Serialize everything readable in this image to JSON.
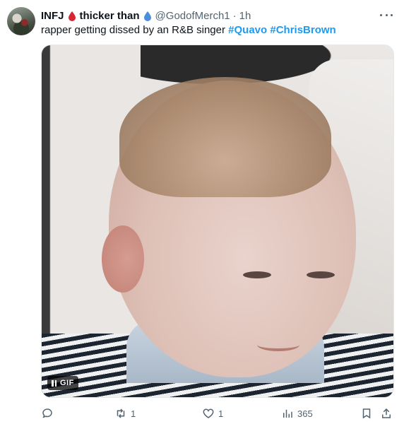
{
  "author": {
    "display_name": "INFJ",
    "display_name_suffix": "thicker than",
    "handle": "@GodofMerch1",
    "separator": "·",
    "timestamp": "1h",
    "drop1_color": "#d6262f",
    "drop2_color": "#4a90d9"
  },
  "tweet": {
    "text": "rapper getting dissed by an R&B singer",
    "hashtags": [
      "#Quavo",
      "#ChrisBrown"
    ]
  },
  "media": {
    "badge_label": "GIF"
  },
  "actions": {
    "reply_count": "",
    "retweet_count": "1",
    "like_count": "1",
    "views_count": "365"
  },
  "colors": {
    "hashtag": "#1d9bf0",
    "secondary_text": "#536471"
  }
}
